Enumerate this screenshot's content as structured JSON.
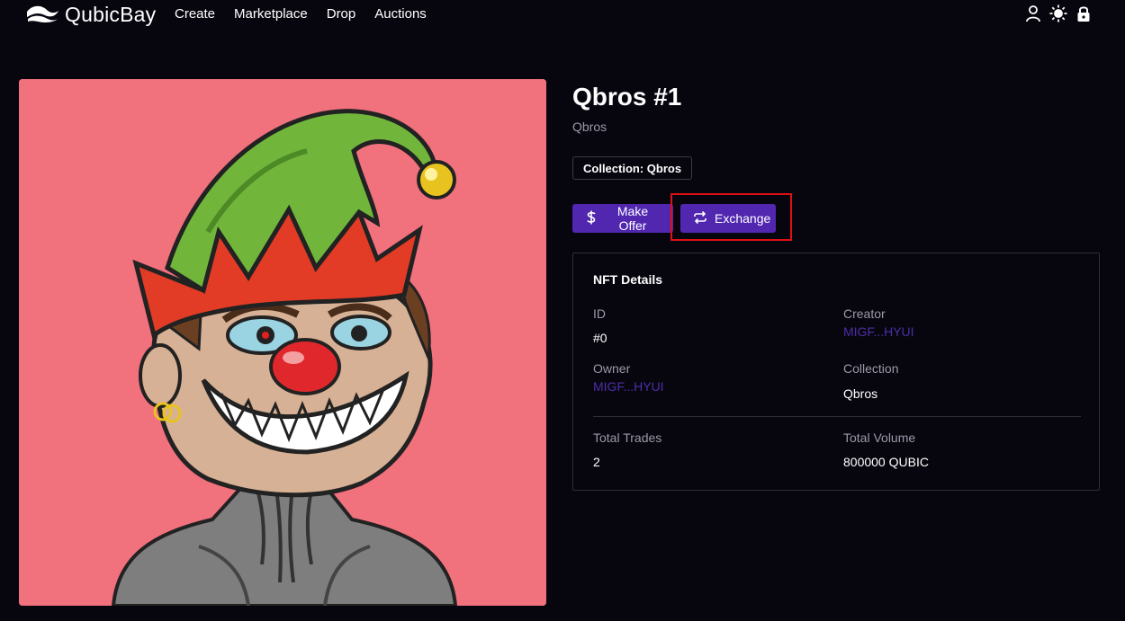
{
  "header": {
    "brand": "QubicBay",
    "nav": [
      "Create",
      "Marketplace",
      "Drop",
      "Auctions"
    ],
    "icons": [
      "user-icon",
      "sun-icon",
      "lock-icon"
    ]
  },
  "item": {
    "title": "Qbros #1",
    "subtitle": "Qbros",
    "collection_badge": "Collection: Qbros",
    "make_offer_label": "Make Offer",
    "exchange_label": "Exchange"
  },
  "details": {
    "heading": "NFT Details",
    "id_label": "ID",
    "id_value": "#0",
    "creator_label": "Creator",
    "creator_value": "MIGF...HYUI",
    "owner_label": "Owner",
    "owner_value": "MIGF...HYUI",
    "collection_label": "Collection",
    "collection_value": "Qbros",
    "total_trades_label": "Total Trades",
    "total_trades_value": "2",
    "total_volume_label": "Total Volume",
    "total_volume_value": "800000 QUBIC"
  },
  "colors": {
    "background": "#07060f",
    "accent": "#5127b0",
    "link": "#4d2ea6",
    "art_background": "#f1717d",
    "highlight": "#e00f16"
  }
}
